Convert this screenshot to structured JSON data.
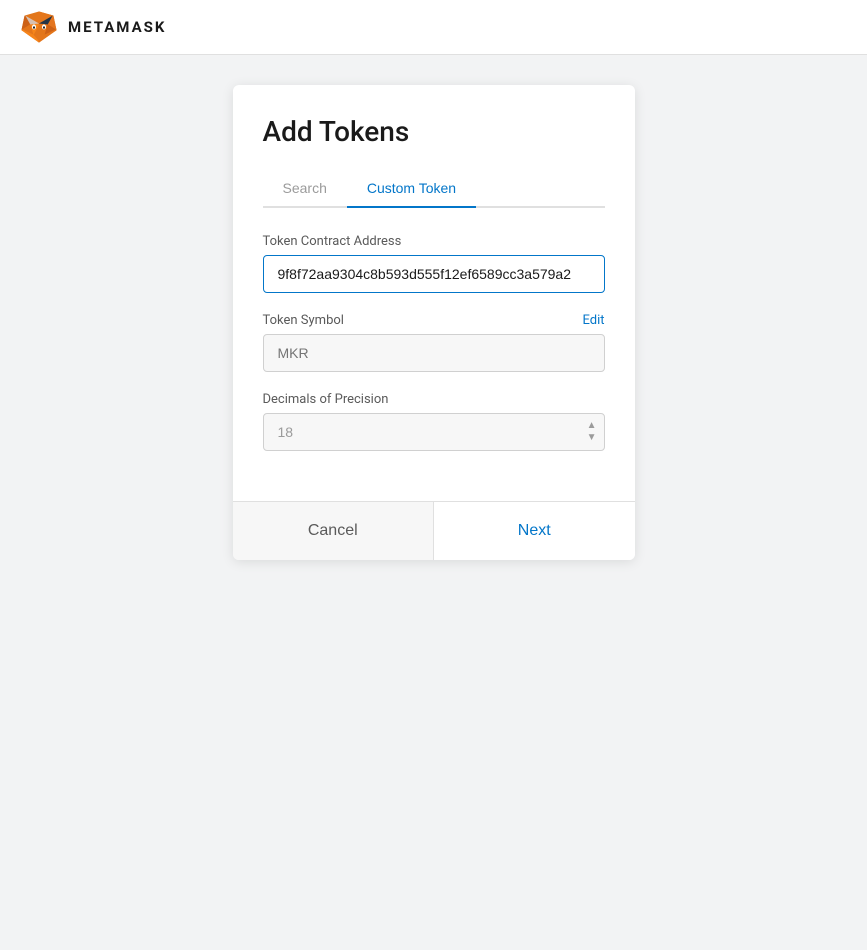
{
  "header": {
    "brand": "METAMASK"
  },
  "card": {
    "title": "Add Tokens",
    "tabs": [
      {
        "id": "search",
        "label": "Search",
        "active": false
      },
      {
        "id": "custom-token",
        "label": "Custom Token",
        "active": true
      }
    ],
    "form": {
      "contractAddress": {
        "label": "Token Contract Address",
        "value": "9f8f72aa9304c8b593d555f12ef6589cc3a579a2",
        "placeholder": ""
      },
      "tokenSymbol": {
        "label": "Token Symbol",
        "editLabel": "Edit",
        "placeholder": "MKR"
      },
      "decimals": {
        "label": "Decimals of Precision",
        "value": "18"
      }
    },
    "footer": {
      "cancelLabel": "Cancel",
      "nextLabel": "Next"
    }
  }
}
